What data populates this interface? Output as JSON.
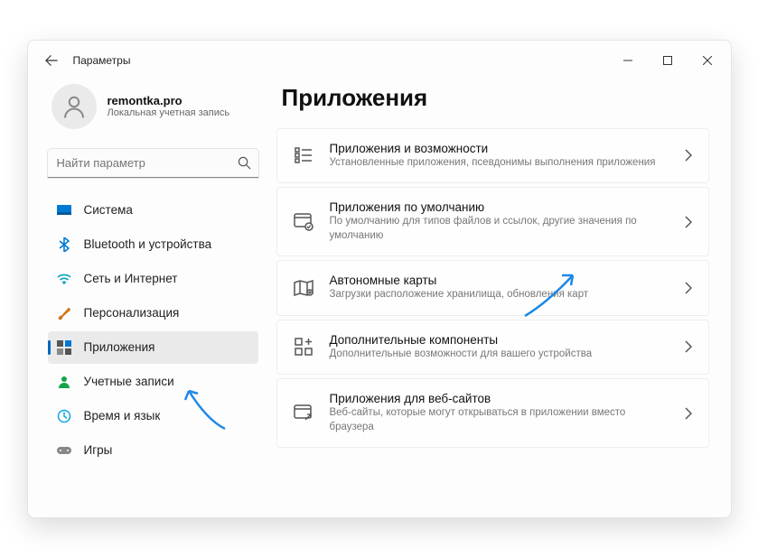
{
  "titlebar": {
    "title": "Параметры"
  },
  "profile": {
    "name": "remontka.pro",
    "sub": "Локальная учетная запись"
  },
  "search": {
    "placeholder": "Найти параметр"
  },
  "sidebar": {
    "items": [
      {
        "label": "Система"
      },
      {
        "label": "Bluetooth и устройства"
      },
      {
        "label": "Сеть и Интернет"
      },
      {
        "label": "Персонализация"
      },
      {
        "label": "Приложения"
      },
      {
        "label": "Учетные записи"
      },
      {
        "label": "Время и язык"
      },
      {
        "label": "Игры"
      }
    ]
  },
  "main": {
    "title": "Приложения",
    "cards": [
      {
        "title": "Приложения и возможности",
        "sub": "Установленные приложения, псевдонимы выполнения приложения"
      },
      {
        "title": "Приложения по умолчанию",
        "sub": "По умолчанию для типов файлов и ссылок, другие значения по умолчанию"
      },
      {
        "title": "Автономные карты",
        "sub": "Загрузки расположение хранилища, обновления карт"
      },
      {
        "title": "Дополнительные компоненты",
        "sub": "Дополнительные возможности для вашего устройства"
      },
      {
        "title": "Приложения для веб-сайтов",
        "sub": "Веб-сайты, которые могут открываться в приложении вместо браузера"
      }
    ]
  }
}
